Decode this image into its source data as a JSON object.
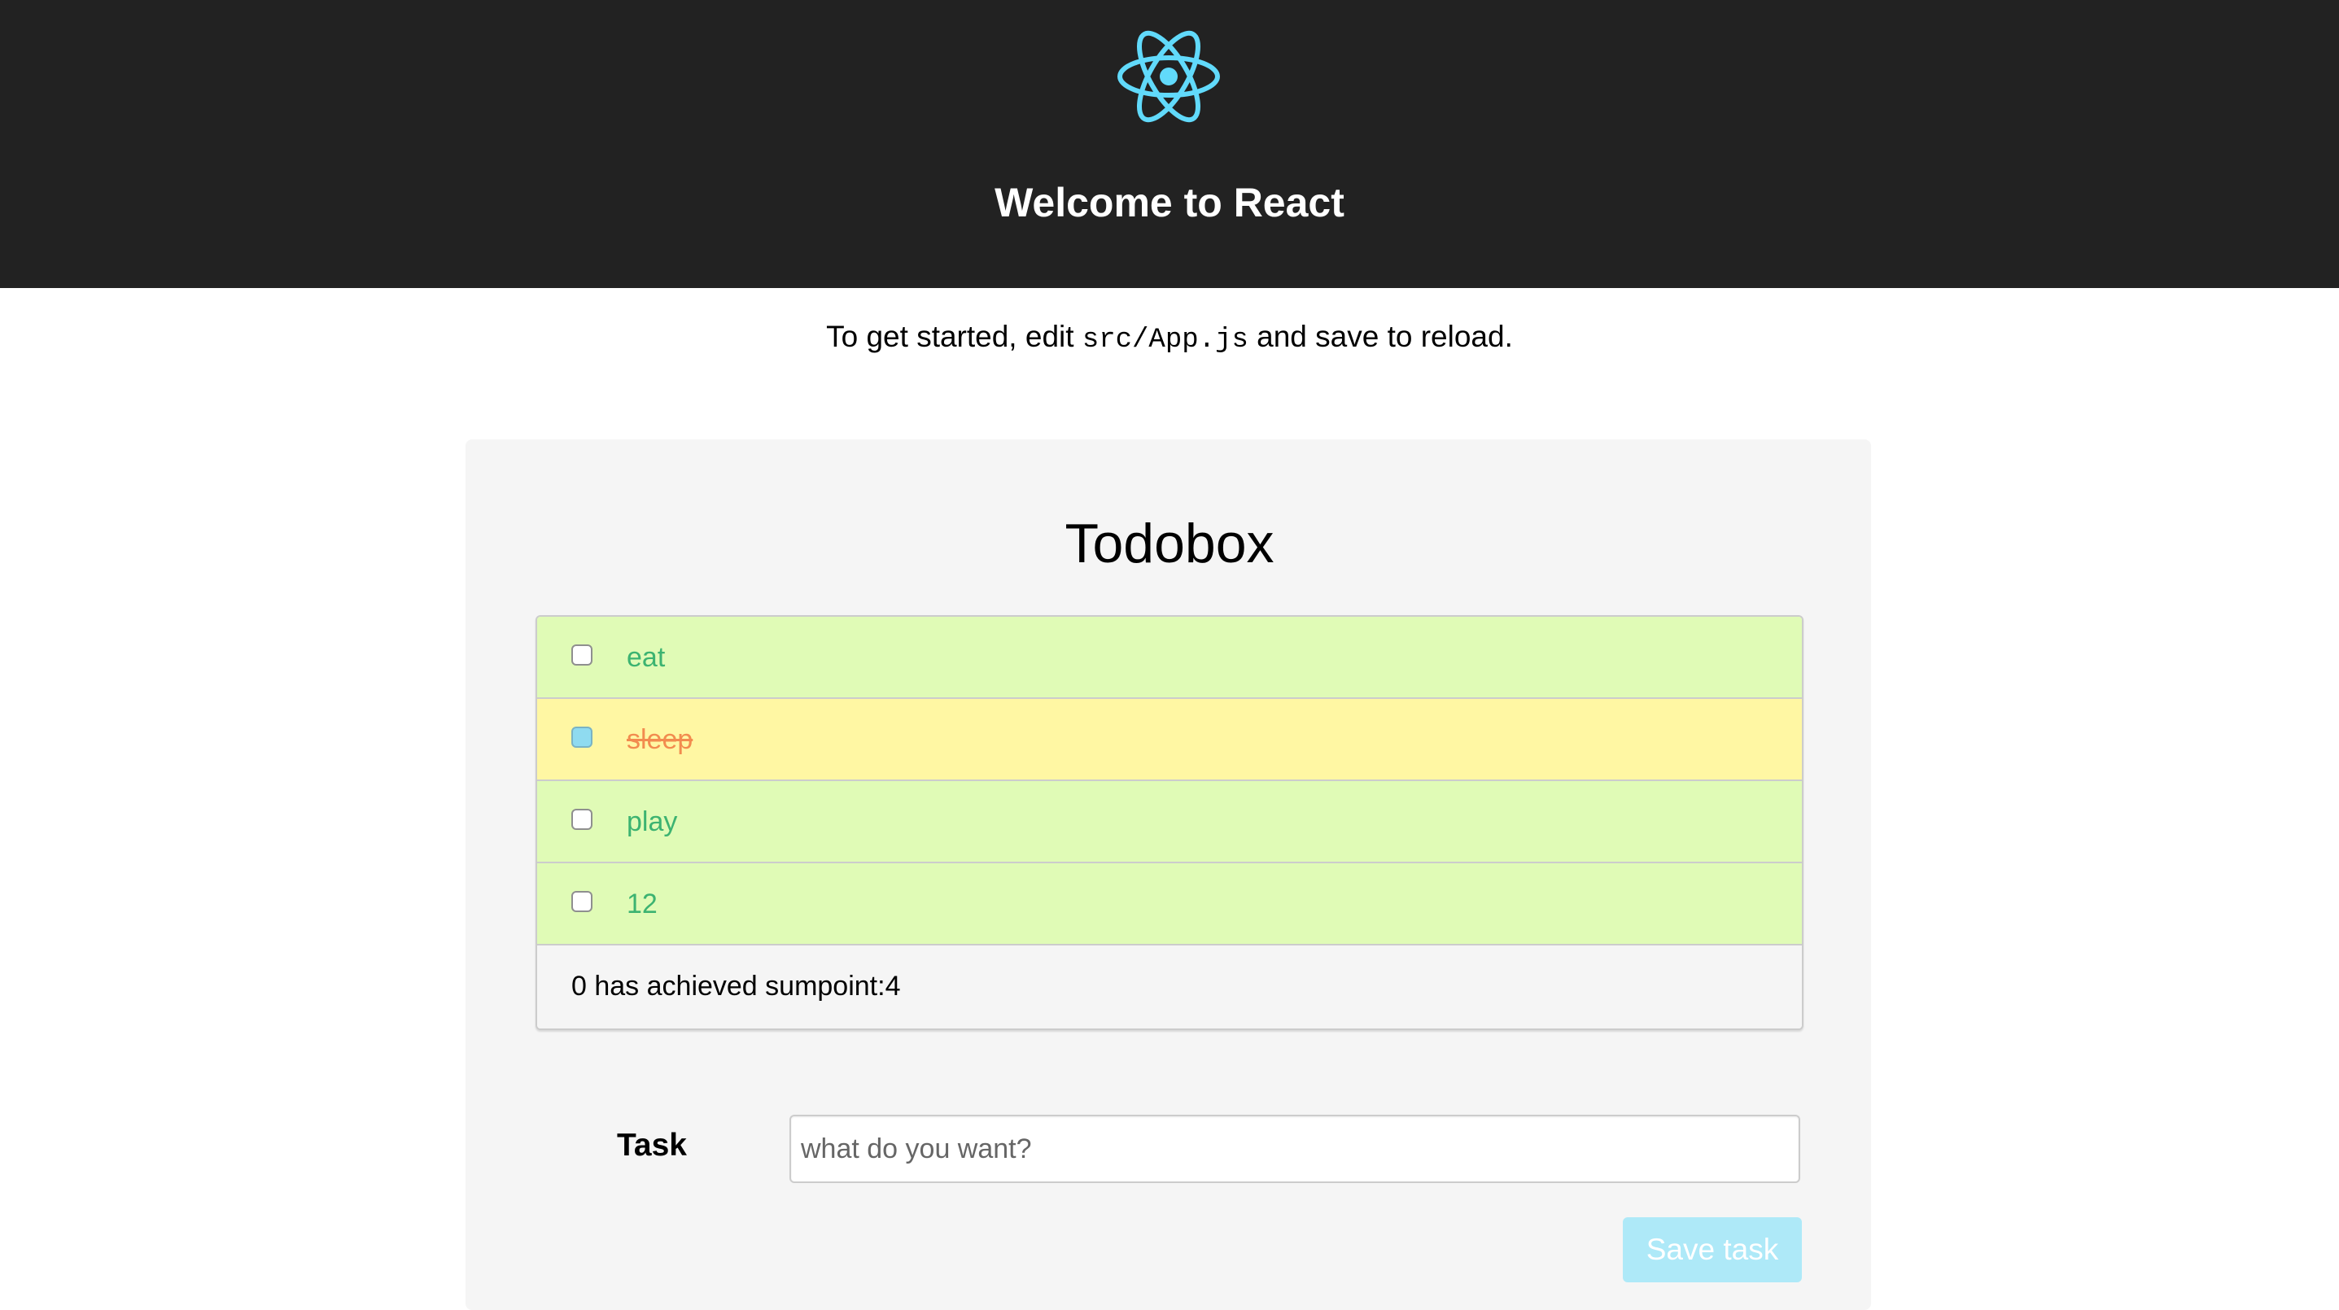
{
  "header": {
    "logo_icon": "react-atom-icon",
    "title": "Welcome to React",
    "background": "#222222",
    "logo_color": "#61dafb"
  },
  "intro": {
    "before": "To get started, edit ",
    "code": "src/App.js",
    "after": " and save to reload."
  },
  "todobox": {
    "title": "Todobox",
    "items": [
      {
        "label": "eat",
        "checked": false
      },
      {
        "label": "sleep",
        "checked": true
      },
      {
        "label": "play",
        "checked": false
      },
      {
        "label": "12",
        "checked": false
      }
    ],
    "summary": "0 has achieved sumpoint:4",
    "colors": {
      "pending_bg": "#e0fbb6",
      "pending_text": "#3cb371",
      "done_bg": "#fff7a3",
      "done_text": "#f28c4f"
    }
  },
  "form": {
    "task_label": "Task",
    "task_value": "",
    "task_placeholder": "what do you want?",
    "save_label": "Save task",
    "save_color": "#aee9f8"
  }
}
